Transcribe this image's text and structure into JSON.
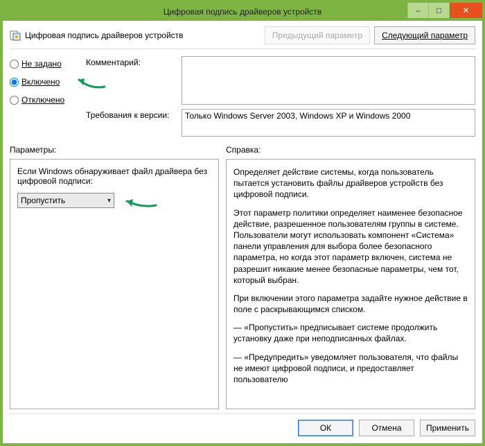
{
  "window": {
    "title": "Цифровая подпись драйверов устройств"
  },
  "titlebar": {
    "minimize": "–",
    "maximize": "□",
    "close": "✕"
  },
  "header": {
    "policy_title": "Цифровая подпись драйверов устройств",
    "prev": "Предыдущий параметр",
    "next": "Следующий параметр"
  },
  "state": {
    "not_configured": "Не задано",
    "enabled": "Включено",
    "disabled": "Отключено",
    "selected": "enabled"
  },
  "fields": {
    "comment_label": "Комментарий:",
    "comment_value": "",
    "version_label": "Требования к версии:",
    "version_value": "Только Windows Server 2003, Windows XP и Windows 2000"
  },
  "sections": {
    "options": "Параметры:",
    "help": "Справка:"
  },
  "options": {
    "prompt": "Если Windows обнаруживает файл драйвера без цифровой подписи:",
    "selected": "Пропустить"
  },
  "help": {
    "p1": "Определяет действие системы, когда пользователь пытается установить файлы драйверов устройств без цифровой подписи.",
    "p2": "Этот параметр политики определяет наименее безопасное действие, разрешенное пользователям группы в системе. Пользователи могут использовать компонент «Система» панели управления для выбора более безопасного параметра, но когда этот параметр включен, система не разрешит никакие менее безопасные параметры, чем тот, который выбран.",
    "p3": "При включении этого параметра задайте нужное действие в поле с раскрывающимся списком.",
    "p4": "— «Пропустить» предписывает системе продолжить установку даже при неподписанных файлах.",
    "p5": "— «Предупредить» уведомляет пользователя, что файлы не имеют цифровой подписи, и предоставляет пользователю"
  },
  "footer": {
    "ok": "ОК",
    "cancel": "Отмена",
    "apply": "Применить"
  }
}
